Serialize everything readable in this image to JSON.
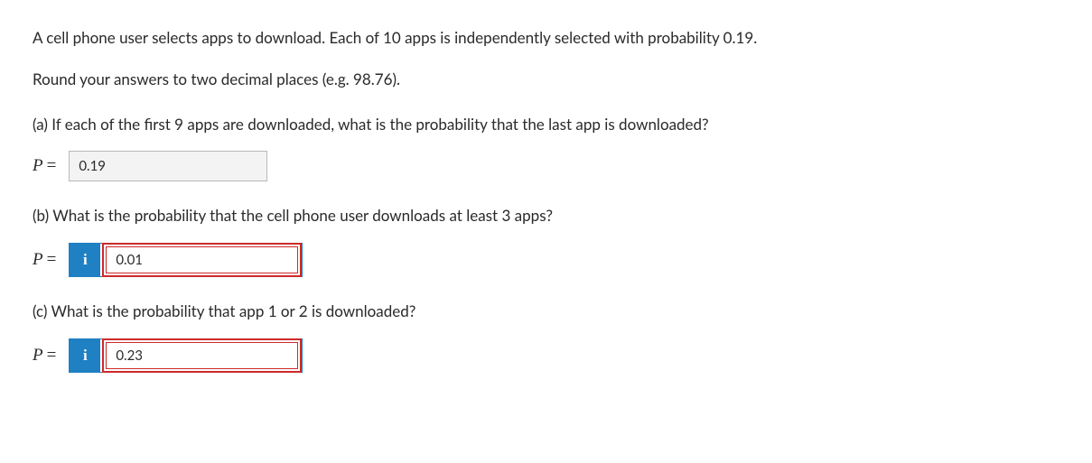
{
  "intro": {
    "line1": "A cell phone user selects apps to download. Each of 10 apps is independently selected with probability 0.19.",
    "line2": "Round your answers to two decimal places (e.g. 98.76)."
  },
  "plabel_var": "P",
  "plabel_eq": "=",
  "info_icon": "i",
  "parts": {
    "a": {
      "prompt": "(a) If each of the first 9 apps are downloaded, what is the probability that the last app is downloaded?",
      "value": "0.19"
    },
    "b": {
      "prompt": "(b) What is the probability that the cell phone user downloads at least 3 apps?",
      "value": "0.01"
    },
    "c": {
      "prompt": "(c) What is the probability that app 1 or 2 is downloaded?",
      "value": "0.23"
    }
  }
}
